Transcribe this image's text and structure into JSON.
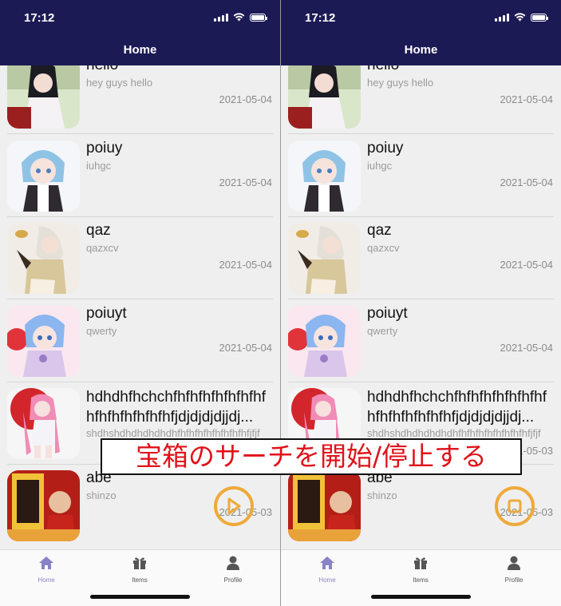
{
  "status": {
    "time": "17:12"
  },
  "header": {
    "title": "Home"
  },
  "items": [
    {
      "title": "hello",
      "subtitle": "hey guys hello",
      "date": "2021-05-04"
    },
    {
      "title": "poiuy",
      "subtitle": "iuhgc",
      "date": "2021-05-04"
    },
    {
      "title": "qaz",
      "subtitle": "qazxcv",
      "date": "2021-05-04"
    },
    {
      "title": "poiuyt",
      "subtitle": "qwerty",
      "date": "2021-05-04"
    },
    {
      "title": "hdhdhfhchchfhfhfhfhfhfhfhfhfhfhfhfhfhfhfjdjdjdjdjjdj...",
      "subtitle": "shdhshdhdhdhdhdhfhfhfhfhfhfhfhfhfjfjf",
      "date": ""
    },
    {
      "title": "abe",
      "subtitle": "shinzo",
      "date": "2021-05-03"
    }
  ],
  "right_partial_dates": {
    "row5": "2021-05-03"
  },
  "tabs": [
    {
      "label": "Home",
      "icon": "home-icon"
    },
    {
      "label": "Items",
      "icon": "gift-icon"
    },
    {
      "label": "Profile",
      "icon": "person-icon"
    }
  ],
  "fab": {
    "left_state": "play",
    "right_state": "stop"
  },
  "caption": "宝箱のサーチを開始/停止する",
  "colors": {
    "header": "#1c1a55",
    "accent": "#eeaa3a",
    "caption": "#e0121a",
    "tab_active": "#8a82c8"
  }
}
